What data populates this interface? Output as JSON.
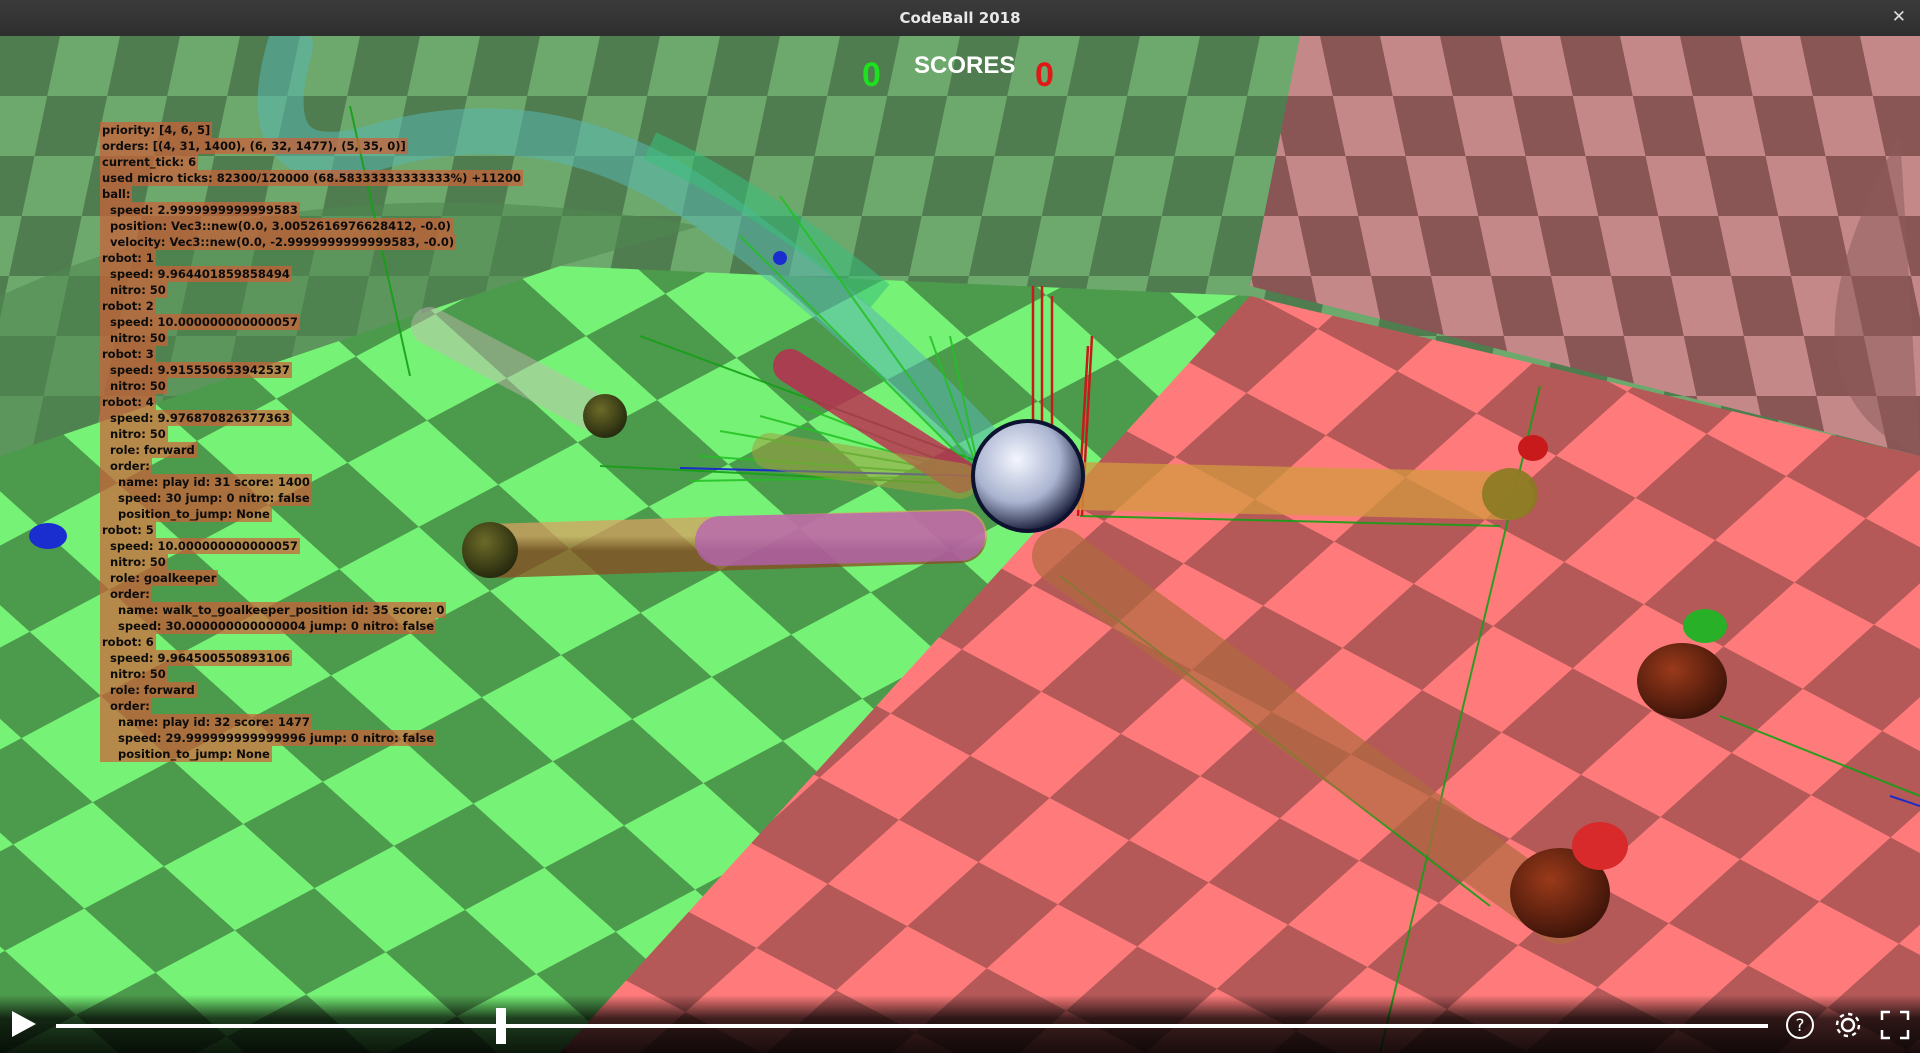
{
  "window": {
    "title": "CodeBall 2018",
    "close_icon": "close-icon"
  },
  "scoreboard": {
    "left_score": "0",
    "label": "SCORES",
    "right_score": "0",
    "left_color": "#1fe01f",
    "right_color": "#e01818"
  },
  "debug_lines": [
    "priority: [4, 6, 5]",
    "orders: [(4, 31, 1400), (6, 32, 1477), (5, 35, 0)]",
    "current_tick: 6",
    "used micro ticks: 82300/120000 (68.58333333333333%) +11200",
    "ball:",
    "  speed: 2.9999999999999583",
    "  position: Vec3::new(0.0, 3.0052616976628412, -0.0)",
    "  velocity: Vec3::new(0.0, -2.9999999999999583, -0.0)",
    "robot: 1",
    "  speed: 9.964401859858494",
    "  nitro: 50",
    "robot: 2",
    "  speed: 10.000000000000057",
    "  nitro: 50",
    "robot: 3",
    "  speed: 9.915550653942537",
    "  nitro: 50",
    "robot: 4",
    "  speed: 9.976870826377363",
    "  nitro: 50",
    "  role: forward",
    "  order:",
    "    name: play id: 31 score: 1400",
    "    speed: 30 jump: 0 nitro: false",
    "    position_to_jump: None",
    "robot: 5",
    "  speed: 10.000000000000057",
    "  nitro: 50",
    "  role: goalkeeper",
    "  order:",
    "    name: walk_to_goalkeeper_position id: 35 score: 0",
    "    speed: 30.000000000000004 jump: 0 nitro: false",
    "robot: 6",
    "  speed: 9.964500550893106",
    "  nitro: 50",
    "  role: forward",
    "  order:",
    "    name: play id: 32 score: 1477",
    "    speed: 29.999999999999996 jump: 0 nitro: false",
    "    position_to_jump: None"
  ],
  "playback": {
    "progress": 0.26,
    "play_icon": "play-icon",
    "help_icon": "help-icon",
    "settings_icon": "gear-icon",
    "fullscreen_icon": "fullscreen-icon"
  },
  "colors": {
    "green_team": "#66ff66",
    "red_team": "#ff7777",
    "ball": "#c8d2e8"
  }
}
